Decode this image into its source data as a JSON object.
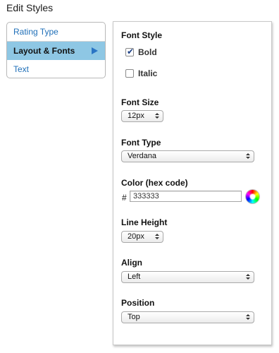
{
  "header": {
    "title": "Edit Styles"
  },
  "nav": {
    "items": [
      {
        "label": "Rating Type",
        "active": false
      },
      {
        "label": "Layout & Fonts",
        "active": true
      },
      {
        "label": "Text",
        "active": false
      }
    ],
    "active_color": "#8ec7e4",
    "link_color": "#1f6fb8"
  },
  "panel": {
    "font_style": {
      "label": "Font Style",
      "bold": {
        "label": "Bold",
        "checked": true
      },
      "italic": {
        "label": "Italic",
        "checked": false
      }
    },
    "font_size": {
      "label": "Font Size",
      "value": "12px"
    },
    "font_type": {
      "label": "Font Type",
      "value": "Verdana"
    },
    "color": {
      "label": "Color (hex code)",
      "prefix": "#",
      "value": "333333",
      "icon": "color-wheel-icon"
    },
    "line_height": {
      "label": "Line Height",
      "value": "20px"
    },
    "align": {
      "label": "Align",
      "value": "Left"
    },
    "position": {
      "label": "Position",
      "value": "Top"
    }
  }
}
